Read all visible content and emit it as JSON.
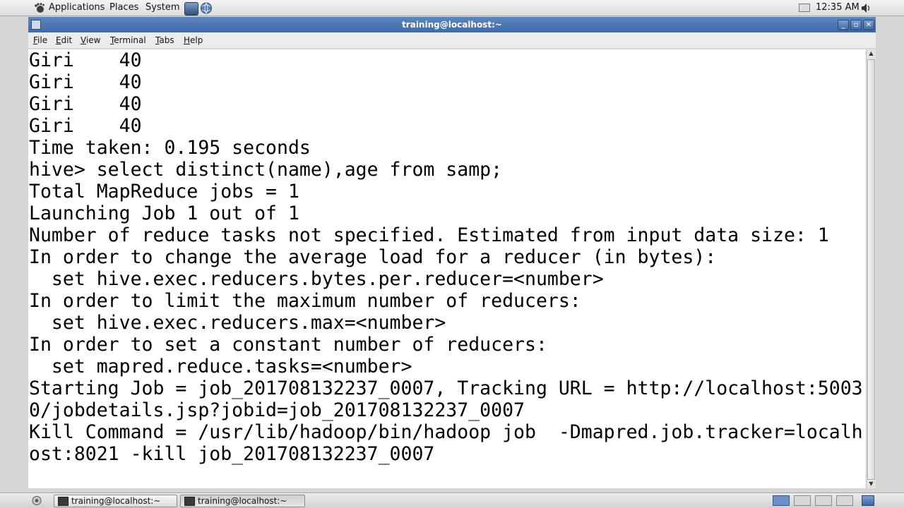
{
  "top_panel": {
    "menus": [
      "Applications",
      "Places",
      "System"
    ],
    "clock": "12:35 AM"
  },
  "window": {
    "title": "training@localhost:~",
    "menu": [
      "File",
      "Edit",
      "View",
      "Terminal",
      "Tabs",
      "Help"
    ]
  },
  "terminal": {
    "lines": [
      "Giri    40",
      "Giri    40",
      "Giri    40",
      "Giri    40",
      "Time taken: 0.195 seconds",
      "hive> select distinct(name),age from samp;",
      "Total MapReduce jobs = 1",
      "Launching Job 1 out of 1",
      "Number of reduce tasks not specified. Estimated from input data size: 1",
      "In order to change the average load for a reducer (in bytes):",
      "  set hive.exec.reducers.bytes.per.reducer=<number>",
      "In order to limit the maximum number of reducers:",
      "  set hive.exec.reducers.max=<number>",
      "In order to set a constant number of reducers:",
      "  set mapred.reduce.tasks=<number>",
      "Starting Job = job_201708132237_0007, Tracking URL = http://localhost:5003",
      "0/jobdetails.jsp?jobid=job_201708132237_0007",
      "Kill Command = /usr/lib/hadoop/bin/hadoop job  -Dmapred.job.tracker=localh",
      "ost:8021 -kill job_201708132237_0007"
    ]
  },
  "taskbar": {
    "tasks": [
      "training@localhost:~",
      "training@localhost:~"
    ]
  }
}
